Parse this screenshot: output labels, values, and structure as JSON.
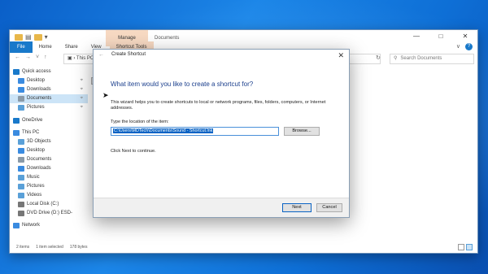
{
  "explorer": {
    "quick_access_suffix": "▾",
    "tool_group_label": "Manage",
    "title": "Documents",
    "controls": [
      "—",
      "□",
      "✕"
    ],
    "tabs": [
      "File",
      "Home",
      "Share",
      "View",
      "Shortcut Tools"
    ],
    "expand_label": "∨",
    "help_label": "?",
    "address": "This PC",
    "search_placeholder": "Search Documents",
    "nav_items": [
      {
        "label": "Quick access",
        "icon": "star-icon",
        "color": "#1979ca",
        "pinned": false
      },
      {
        "label": "Desktop",
        "icon": "desktop-icon",
        "color": "#3a8be0",
        "pinned": true
      },
      {
        "label": "Downloads",
        "icon": "download-icon",
        "color": "#3a8be0",
        "pinned": true
      },
      {
        "label": "Documents",
        "icon": "documents-icon",
        "color": "#8a9aa8",
        "pinned": true,
        "selected": true
      },
      {
        "label": "Pictures",
        "icon": "pictures-icon",
        "color": "#5aa0d8",
        "pinned": true
      },
      {
        "label": "OneDrive",
        "icon": "cloud-icon",
        "color": "#1979ca",
        "pinned": false
      },
      {
        "label": "This PC",
        "icon": "computer-icon",
        "color": "#3a8be0",
        "pinned": false
      },
      {
        "label": "3D Objects",
        "icon": "cube-icon",
        "color": "#5aa0d8",
        "pinned": false
      },
      {
        "label": "Desktop",
        "icon": "desktop-icon",
        "color": "#3a8be0",
        "pinned": false
      },
      {
        "label": "Documents",
        "icon": "documents-icon",
        "color": "#8a9aa8",
        "pinned": false
      },
      {
        "label": "Downloads",
        "icon": "download-icon",
        "color": "#3a8be0",
        "pinned": false
      },
      {
        "label": "Music",
        "icon": "music-icon",
        "color": "#5aa0d8",
        "pinned": false
      },
      {
        "label": "Pictures",
        "icon": "pictures-icon",
        "color": "#5aa0d8",
        "pinned": false
      },
      {
        "label": "Videos",
        "icon": "videos-icon",
        "color": "#5aa0d8",
        "pinned": false
      },
      {
        "label": "Local Disk (C:)",
        "icon": "disk-icon",
        "color": "#777777",
        "pinned": false
      },
      {
        "label": "DVD Drive (D:) ESD-",
        "icon": "dvd-icon",
        "color": "#777777",
        "pinned": false
      },
      {
        "label": "Network",
        "icon": "network-icon",
        "color": "#3a8be0",
        "pinned": false
      }
    ],
    "content_file_label": "S",
    "status": {
      "items": "2 items",
      "selected": "1 item selected",
      "size": "178 bytes"
    }
  },
  "dialog": {
    "title": "Create Shortcut",
    "heading": "What item would you like to create a shortcut for?",
    "description": "This wizard helps you to create shortcuts to local or network programs, files, folders, computers, or Internet addresses.",
    "location_label": "Type the location of the item:",
    "location_value": "C:\\Users\\MDTech\\Documents\\Sound - Shortcut.lnk",
    "browse_label": "Browse...",
    "hint": "Click Next to continue.",
    "next_label": "Next",
    "cancel_label": "Cancel"
  }
}
